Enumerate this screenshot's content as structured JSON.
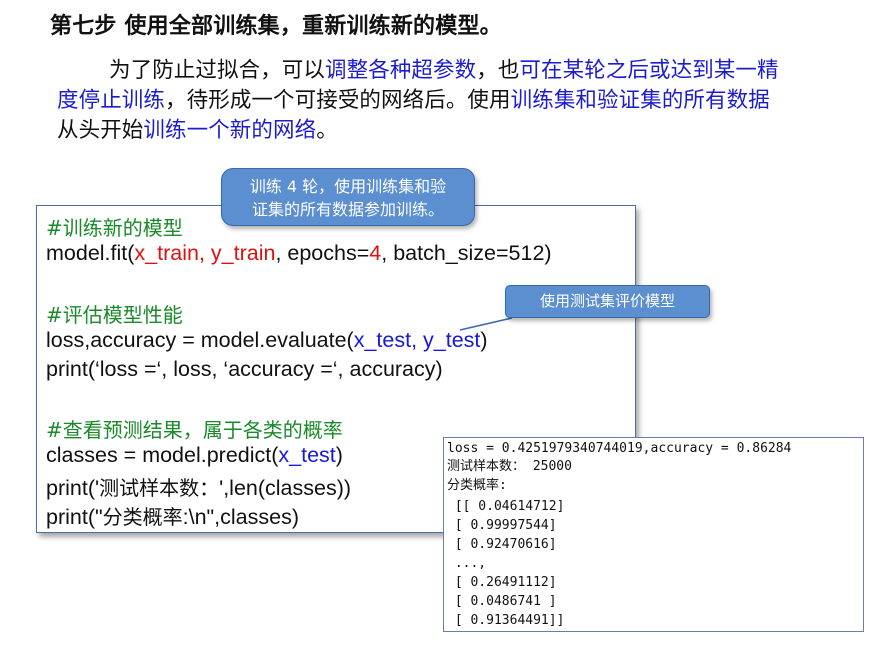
{
  "title": "第七步 使用全部训练集，重新训练新的模型。",
  "paragraph": {
    "l1_a": "为了防止过拟合，可以",
    "l1_b": "调整各种超参数",
    "l1_c": "，也",
    "l1_d": "可在某轮之后或达到某一精",
    "l2_a": "度停止训练",
    "l2_b": "，待形成一个可接受的网络后。使用",
    "l2_c": "训练集和验证集的所有数据",
    "l3_a": "从头开始",
    "l3_b": "训练一个新的网络",
    "l3_c": "。"
  },
  "code": {
    "c1": "#训练新的模型",
    "l2_a": "model.fit(",
    "l2_b": "x_train, y_train",
    "l2_c": ", epochs=",
    "l2_d": "4",
    "l2_e": ", batch_size=512)",
    "c2": "#评估模型性能",
    "l4_a": "loss,accuracy  = model.evaluate(",
    "l4_b": "x_test, y_test",
    "l4_c": ")",
    "l5": "print(‘loss =‘, loss, ‘accuracy =‘, accuracy)",
    "c3": "#查看预测结果，属于各类的概率",
    "l7_a": "classes = model.predict(",
    "l7_b": "x_test",
    "l7_c": ")",
    "l8_a": "print('",
    "l8_b": "测试样本数：",
    "l8_c": "',len(classes))",
    "l9_a": "print(\"",
    "l9_b": "分类概率",
    "l9_c": ":\\n\",classes)"
  },
  "callouts": {
    "epochs_note_1": "训练 4 轮，使用训练集和验",
    "epochs_note_2": "证集的所有数据参加训练。",
    "test_note": "使用测试集评价模型"
  },
  "output": {
    "lines": [
      "loss = 0.4251979340744019,accuracy = 0.86284",
      "测试样本数： 25000",
      "分类概率:",
      " [[ 0.04614712]",
      " [ 0.99997544]",
      " [ 0.92470616]",
      " ...,",
      " [ 0.26491112]",
      " [ 0.0486741 ]",
      " [ 0.91364491]]"
    ]
  },
  "colors": {
    "highlight_blue": "#1c1ccf",
    "code_red": "#e01010",
    "comment_green": "#1a8a2a",
    "callout_fill": "#5b8fd0"
  }
}
